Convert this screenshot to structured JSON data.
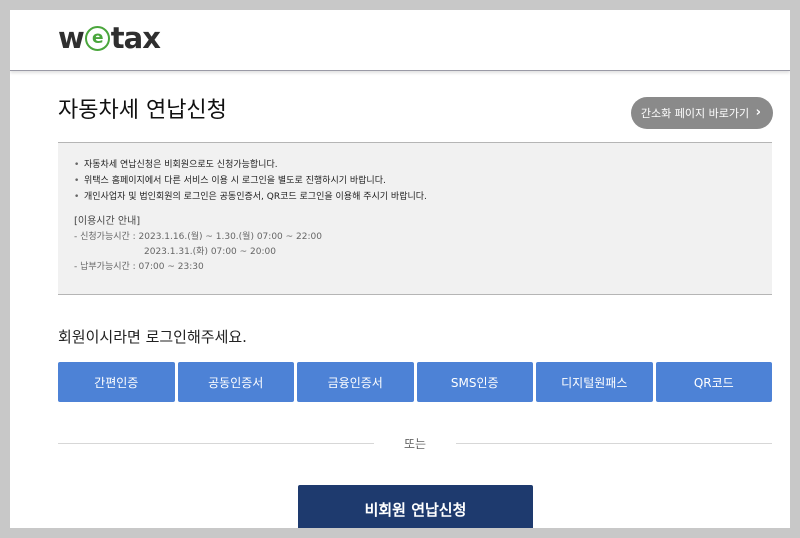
{
  "header": {
    "logo": {
      "prefix": "w",
      "mark": "e",
      "suffix": "tax",
      "mark_color": "#4aa63c"
    }
  },
  "main": {
    "title": "자동차세 연납신청",
    "simple_page_button": {
      "label": "간소화 페이지 바로가기",
      "icon": "chevron-right-icon"
    },
    "notice": {
      "items": [
        "자동차세 연납신청은 비회원으로도 신청가능합니다.",
        "위택스 홈페이지에서 다른 서비스 이용 시 로그인을 별도로 진행하시기 바랍니다.",
        "개인사업자 및 법인회원의 로그인은 공동인증서, QR코드 로그인을 이용해 주시기 바랍니다."
      ],
      "time_title": "[이용시간 안내]",
      "time_rows": [
        "- 신청가능시간 : 2023.1.16.(월) ~ 1.30.(월) 07:00 ~ 22:00",
        "2023.1.31.(화) 07:00 ~ 20:00",
        "- 납부가능시간 : 07:00 ~ 23:30"
      ]
    },
    "login_message": "회원이시라면 로그인해주세요.",
    "auth_buttons": [
      "간편인증",
      "공동인증서",
      "금융인증서",
      "SMS인증",
      "디지털원패스",
      "QR코드"
    ],
    "or_text": "또는",
    "guest_button": "비회원 연납신청"
  },
  "colors": {
    "auth_button_bg": "#4d82d6",
    "guest_button_bg": "#1e3a6e",
    "simple_button_bg": "#8a8a8a"
  }
}
